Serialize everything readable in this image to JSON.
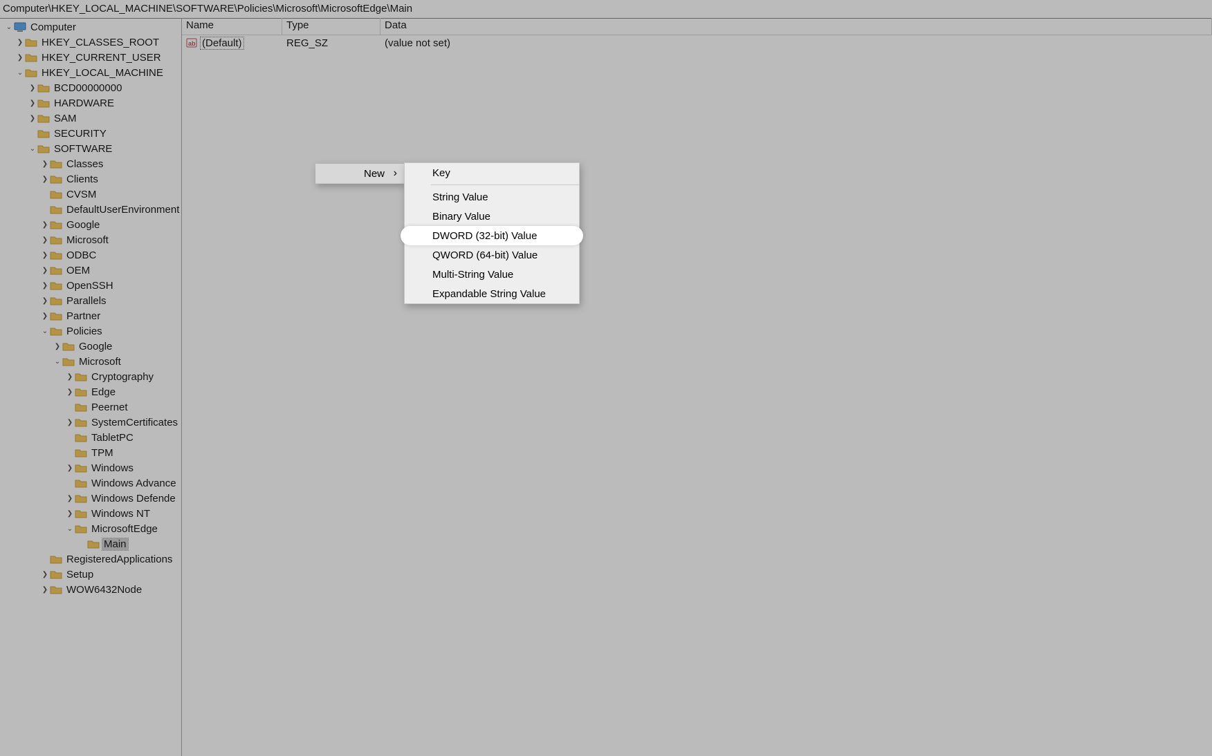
{
  "address_bar": "Computer\\HKEY_LOCAL_MACHINE\\SOFTWARE\\Policies\\Microsoft\\MicrosoftEdge\\Main",
  "tree": {
    "root": "Computer",
    "hives": {
      "hkcr": "HKEY_CLASSES_ROOT",
      "hkcu": "HKEY_CURRENT_USER",
      "hklm": "HKEY_LOCAL_MACHINE"
    },
    "hklm_children": {
      "bcd": "BCD00000000",
      "hardware": "HARDWARE",
      "sam": "SAM",
      "security": "SECURITY",
      "software": "SOFTWARE"
    },
    "software_children": {
      "classes": "Classes",
      "clients": "Clients",
      "cvsm": "CVSM",
      "default_user_env": "DefaultUserEnvironment",
      "google": "Google",
      "microsoft": "Microsoft",
      "odbc": "ODBC",
      "oem": "OEM",
      "openssh": "OpenSSH",
      "parallels": "Parallels",
      "partner": "Partner",
      "policies": "Policies",
      "registered_apps": "RegisteredApplications",
      "setup": "Setup",
      "wow64": "WOW6432Node"
    },
    "policies_children": {
      "google": "Google",
      "microsoft": "Microsoft"
    },
    "policies_microsoft_children": {
      "cryptography": "Cryptography",
      "edge": "Edge",
      "peernet": "Peernet",
      "system_certificates": "SystemCertificates",
      "tabletpc": "TabletPC",
      "tpm": "TPM",
      "windows": "Windows",
      "windows_advanced": "Windows Advance",
      "windows_defender": "Windows Defende",
      "windows_nt": "Windows NT",
      "microsoftedge": "MicrosoftEdge"
    },
    "microsoftedge_children": {
      "main": "Main"
    }
  },
  "list": {
    "headers": {
      "name": "Name",
      "type": "Type",
      "data": "Data"
    },
    "rows": [
      {
        "name": "(Default)",
        "type": "REG_SZ",
        "data": "(value not set)"
      }
    ]
  },
  "context_menu": {
    "new": "New",
    "submenu": {
      "key": "Key",
      "string": "String Value",
      "binary": "Binary Value",
      "dword": "DWORD (32-bit) Value",
      "qword": "QWORD (64-bit) Value",
      "multi_string": "Multi-String Value",
      "expandable_string": "Expandable String Value"
    }
  }
}
